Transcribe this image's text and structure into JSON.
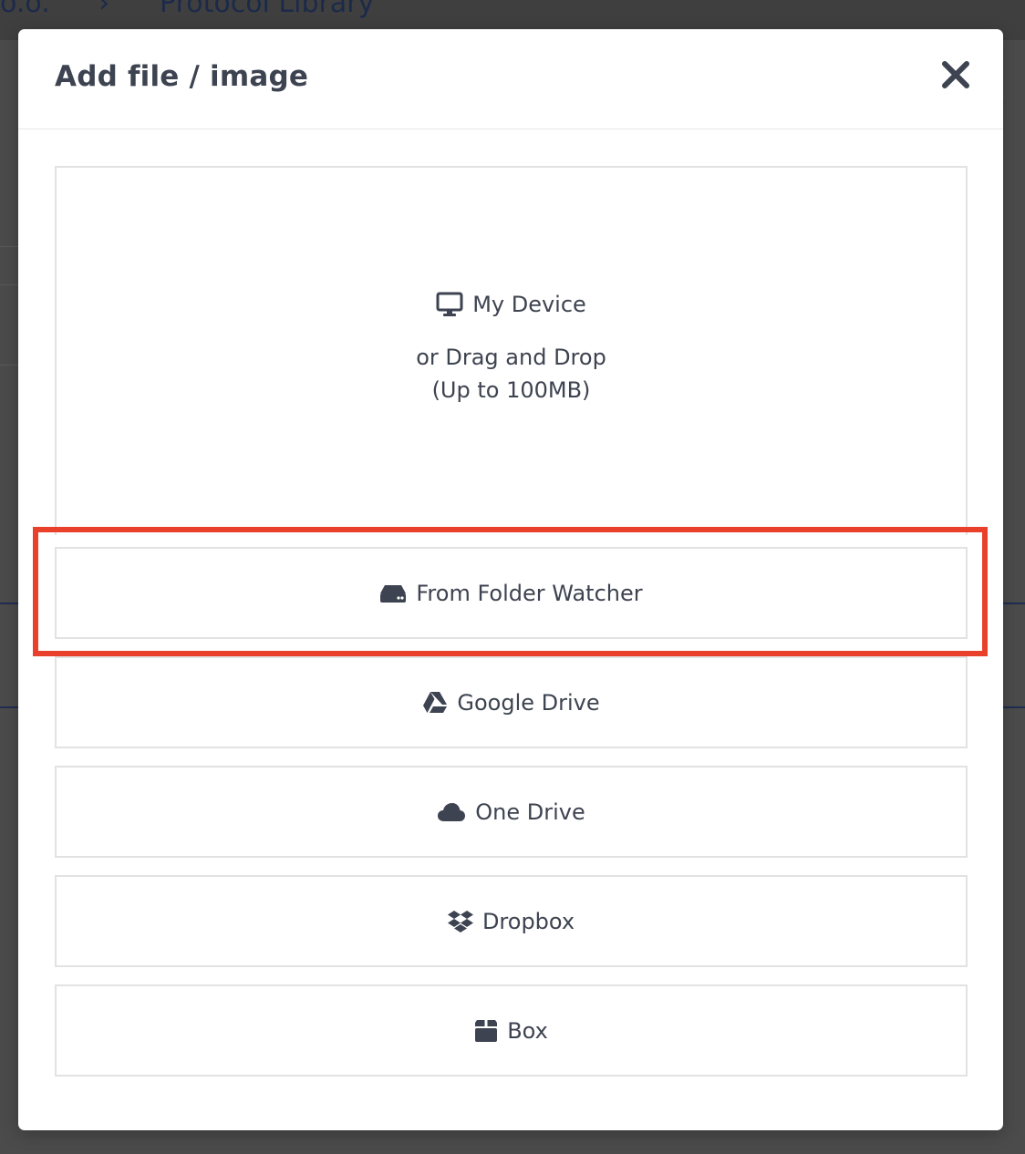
{
  "background": {
    "breadcrumb_prefix": "o.o.",
    "breadcrumb_separator": "›",
    "breadcrumb_current": "Protocol Library"
  },
  "modal": {
    "title": "Add file / image",
    "close_icon": "close-icon",
    "device": {
      "label": "My Device",
      "icon": "monitor-icon",
      "drag_text": "or Drag and Drop",
      "limit_text": "(Up to 100MB)"
    },
    "options": [
      {
        "label": "From Folder Watcher",
        "icon": "hard-drive-icon"
      },
      {
        "label": "Google Drive",
        "icon": "google-drive-icon"
      },
      {
        "label": "One Drive",
        "icon": "cloud-icon"
      },
      {
        "label": "Dropbox",
        "icon": "dropbox-icon"
      },
      {
        "label": "Box",
        "icon": "box-icon"
      }
    ]
  },
  "colors": {
    "highlight": "#e8402b",
    "text": "#3d4350",
    "border": "#e2e2e5"
  }
}
